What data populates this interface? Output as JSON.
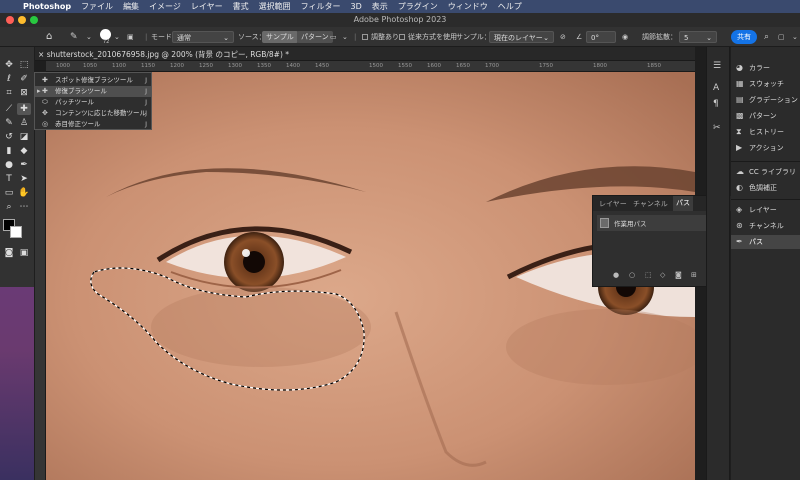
{
  "menubar": {
    "app": "Photoshop",
    "items": [
      "ファイル",
      "編集",
      "イメージ",
      "レイヤー",
      "書式",
      "選択範囲",
      "フィルター",
      "3D",
      "表示",
      "プラグイン",
      "ウィンドウ",
      "ヘルプ"
    ]
  },
  "window": {
    "title": "Adobe Photoshop 2023"
  },
  "options": {
    "brush_size": "72",
    "mode_label": "モード：",
    "mode_value": "通常",
    "source_label": "ソース：",
    "source_sample": "サンプル",
    "source_pattern": "パターン",
    "aligned": "調整あり",
    "legacy": "従来方式を使用",
    "sample_label": "サンプル：",
    "sample_value": "現在のレイヤー",
    "angle": "0°",
    "diffusion_label": "調節拡散：",
    "diffusion_value": "5",
    "share": "共有"
  },
  "document": {
    "tab_title": "shutterstock_2010676958.jpg @ 200% (背景 のコピー, RGB/8#) *"
  },
  "ruler": {
    "h_ticks": [
      "1000",
      "1050",
      "1100",
      "1150",
      "1200",
      "1250",
      "1300",
      "1350",
      "1400",
      "1450",
      "1500",
      "1550",
      "1600",
      "1650",
      "1700",
      "1750",
      "1800",
      "1850"
    ]
  },
  "flyout": {
    "items": [
      {
        "label": "スポット修復ブラシツール",
        "key": "J"
      },
      {
        "label": "修復ブラシツール",
        "key": "J"
      },
      {
        "label": "パッチツール",
        "key": "J"
      },
      {
        "label": "コンテンツに応じた移動ツール",
        "key": "J"
      },
      {
        "label": "赤目修正ツール",
        "key": "J"
      }
    ]
  },
  "paths_panel": {
    "tabs": [
      "レイヤー",
      "チャンネル",
      "パス"
    ],
    "path_name": "作業用パス"
  },
  "right_panel": {
    "group1": [
      "カラー",
      "スウォッチ",
      "グラデーション",
      "パターン",
      "ヒストリー",
      "アクション"
    ],
    "group2": [
      "CC ライブラリ",
      "色調補正"
    ],
    "group3": [
      "レイヤー",
      "チャンネル",
      "パス"
    ]
  },
  "colors": {
    "accent": "#1473e6",
    "menubar": "#3a4a6e",
    "skin": "#c98f70"
  }
}
